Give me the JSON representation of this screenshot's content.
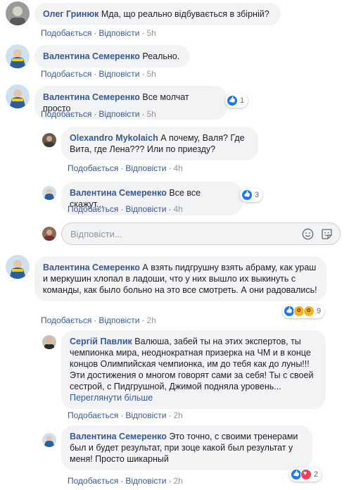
{
  "labels": {
    "like": "Подобається",
    "reply": "Відповісти",
    "dot": "·"
  },
  "reply_box": {
    "placeholder": "Відповісти..."
  },
  "comments": [
    {
      "author": "Олег Гринюк",
      "text": "Мда, що реально відбувається в збірній?",
      "time": "5h"
    },
    {
      "author": "Валентина Семеренко",
      "text": "Реально.",
      "time": "5h"
    },
    {
      "author": "Валентина Семеренко",
      "text": "Все молчат просто",
      "time": "5h",
      "reaction_count": "1"
    },
    {
      "author": "Olexandro Mykolaich",
      "text": "А почему, Валя? Где Вита, где Лена??? Или по приезду?",
      "time": "4h"
    },
    {
      "author": "Валентина Семеренко",
      "text": "Все все скажут...",
      "time": "4h",
      "reaction_count": "3"
    },
    {
      "author": "Валентина Семеренко",
      "text": "А взять пидгрушну взять абраму, как ураш и меркушин хлопал в ладоши, что у них вышло их выкинуть с команды, как было больно на это все смотреть. А они радовались!",
      "time": "2h",
      "reaction_count": "9"
    },
    {
      "author": "Сергій Павлик",
      "text": "Валюша, забей ты на этих экспертов, ты чемпионка мира, неоднократная призерка на ЧМ и в конце концов Олимпийская чемпионка, им до тебя как до луны!!! Эти достижения о многом говорят сами за себя! Ты с своей сестрой, с Пидгрушной, Джимой подняла уровень...",
      "see_more": "Переглянути більше",
      "time": "2h"
    },
    {
      "author": "Валентина Семеренко",
      "text": "Это точно, с своими тренерами был и будет результат, при зоце какой был результат у меня! Просто шикарный",
      "time": "2h",
      "reaction_count": "2"
    }
  ]
}
